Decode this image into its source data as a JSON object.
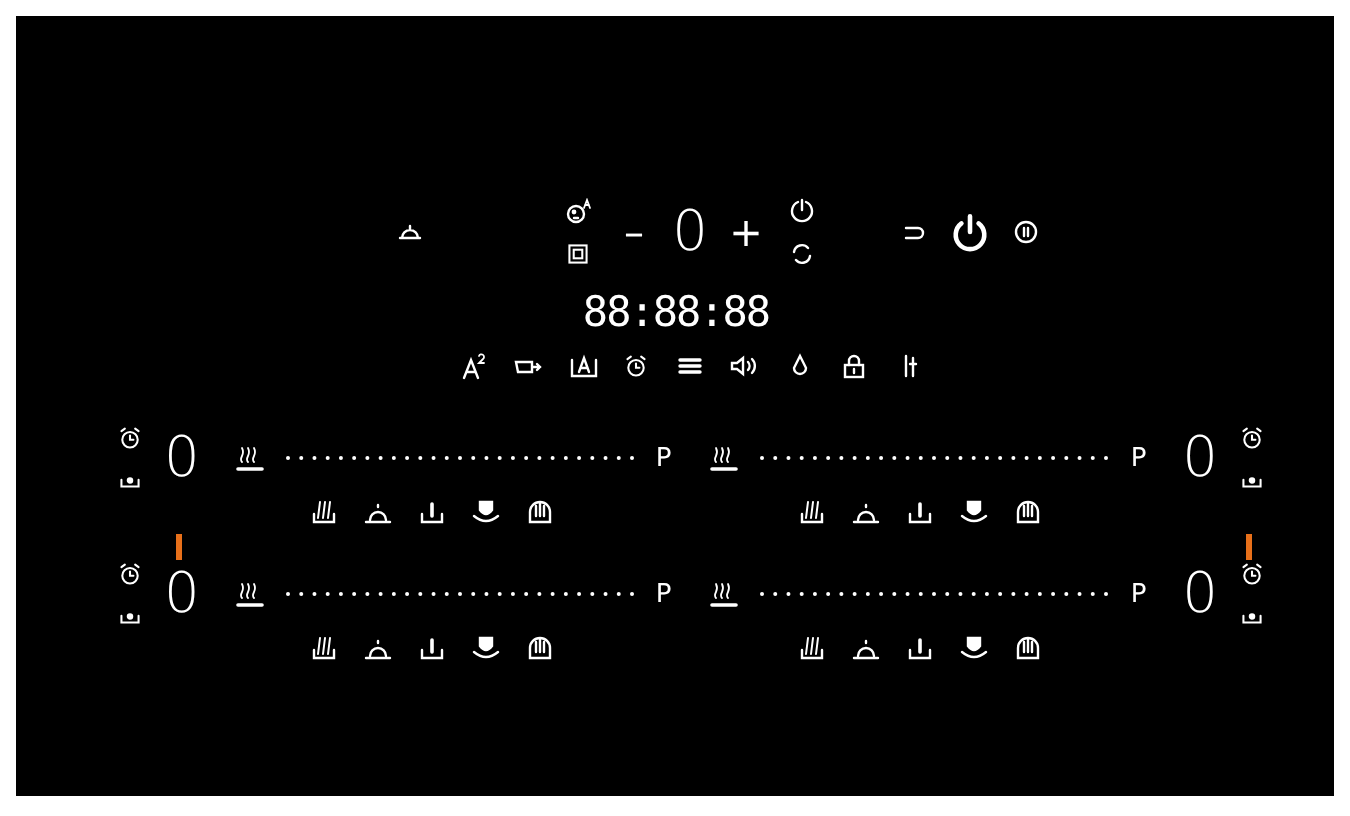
{
  "top_controls": {
    "minus": "–",
    "display": "0",
    "plus": "+"
  },
  "clock": "88:88:88",
  "left_zones": [
    {
      "display": "0",
      "end_label": "P"
    },
    {
      "display": "0",
      "end_label": "P"
    }
  ],
  "right_zones": [
    {
      "display": "0",
      "end_label": "P"
    },
    {
      "display": "0",
      "end_label": "P"
    }
  ]
}
